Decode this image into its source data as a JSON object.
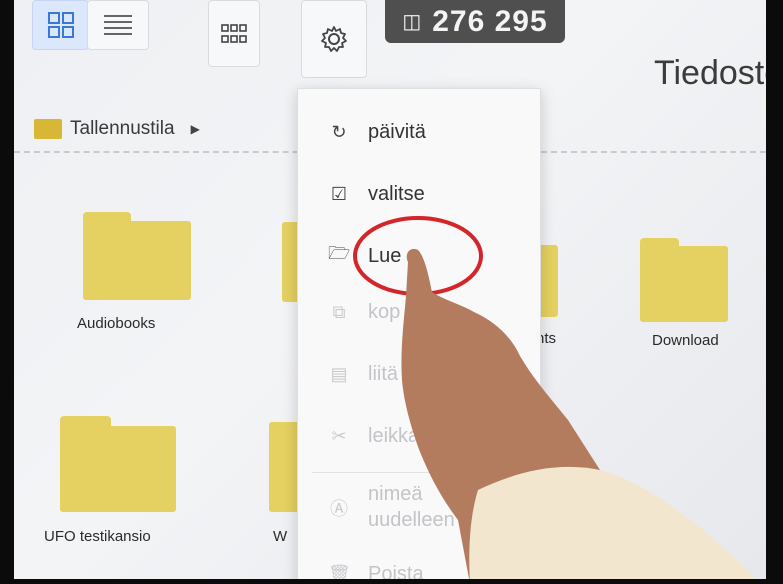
{
  "toolbar": {
    "storage_counter": "276 295"
  },
  "page_title": "Tiedosto",
  "breadcrumb": {
    "label": "Tallennustila"
  },
  "folders": [
    {
      "label": "Audiobooks"
    },
    {
      "label": "Download"
    },
    {
      "label": "UFO testikansio"
    },
    {
      "label": "W"
    },
    {
      "label": "nts"
    }
  ],
  "context_menu": {
    "items": [
      {
        "label": "päivitä",
        "icon": "refresh-icon",
        "enabled": true
      },
      {
        "label": "valitse",
        "icon": "checkbox-icon",
        "enabled": true
      },
      {
        "label": "Lue",
        "icon": "folder-outline-icon",
        "enabled": true
      },
      {
        "label": "kop",
        "icon": "copy-icon",
        "enabled": false
      },
      {
        "label": "liitä",
        "icon": "paste-icon",
        "enabled": false
      },
      {
        "label": "leikkaa",
        "icon": "scissors-icon",
        "enabled": false
      },
      {
        "label": "nimeä uudelleen",
        "icon": "rename-icon",
        "enabled": false
      },
      {
        "label": "Poista",
        "icon": "trash-icon",
        "enabled": false
      }
    ]
  },
  "colors": {
    "folder": "#e4d161",
    "highlight_circle": "#d2262a",
    "selected_view": "#dbe7fb"
  }
}
